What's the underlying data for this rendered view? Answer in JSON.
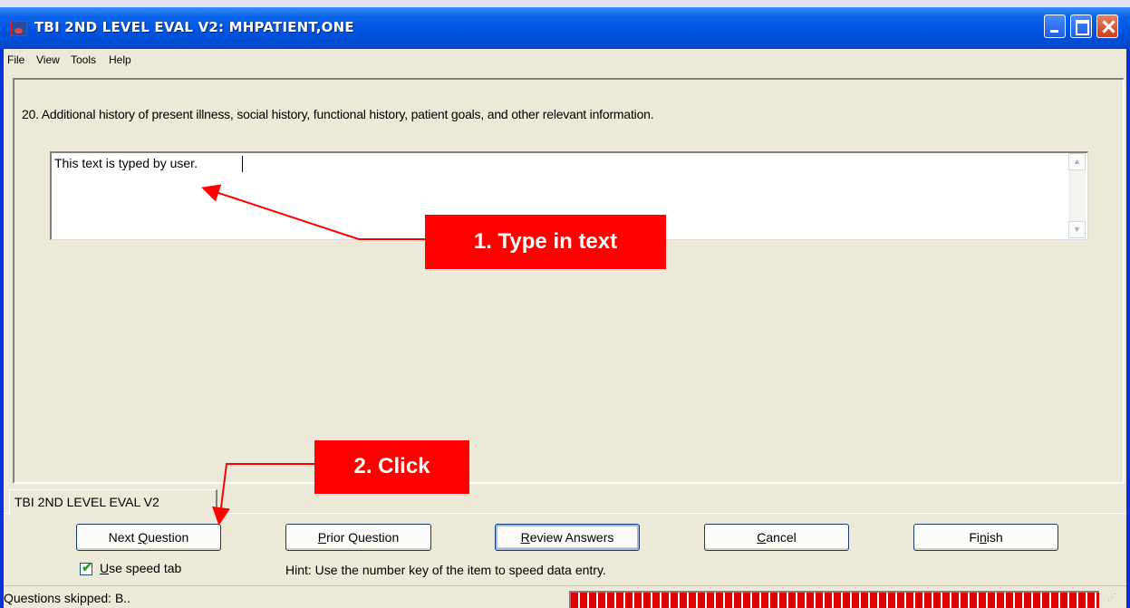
{
  "window": {
    "title": "TBI 2ND LEVEL EVAL V2: MHPATIENT,ONE"
  },
  "menu": {
    "items": [
      "File",
      "View",
      "Tools",
      "Help"
    ]
  },
  "question": {
    "text": "20. Additional history of present illness, social history, functional history, patient goals, and other relevant information.",
    "answer": "This text is typed by user."
  },
  "tab": {
    "label": "TBI 2ND LEVEL EVAL V2"
  },
  "buttons": {
    "next": {
      "prefix": "Next ",
      "accel": "Q",
      "suffix": "uestion"
    },
    "prior": {
      "prefix": "",
      "accel": "P",
      "suffix": "rior Question"
    },
    "review": {
      "prefix": "",
      "accel": "R",
      "suffix": "eview Answers"
    },
    "cancel": {
      "prefix": "",
      "accel": "C",
      "suffix": "ancel"
    },
    "finish": {
      "prefix": "Fi",
      "accel": "n",
      "suffix": "ish"
    }
  },
  "speed_tab": {
    "checked": true,
    "label_accel": "U",
    "label_rest": "se speed tab"
  },
  "hint": "Hint: Use the number key of the item to speed data entry.",
  "status": {
    "text": "Questions skipped: B..",
    "progress": 1.0
  },
  "annotations": {
    "callout_1": "1. Type in text",
    "callout_2": "2. Click"
  },
  "colors": {
    "callout": "#ff0000",
    "titlebar": "#0054e3",
    "progress": "#e00000"
  }
}
